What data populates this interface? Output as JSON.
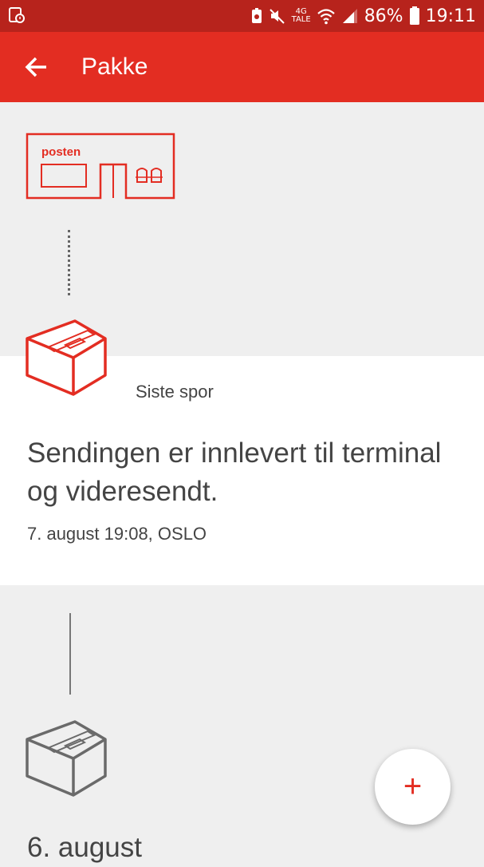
{
  "status_bar": {
    "network": "4G",
    "network_sub": "TALE",
    "battery": "86%",
    "time": "19:11"
  },
  "app_bar": {
    "title": "Pakke",
    "back_icon": "arrow-left-icon"
  },
  "illustration": {
    "sign_text": "posten"
  },
  "latest_event": {
    "label": "Siste spor",
    "message": "Sendingen er innlevert til terminal og videresendt.",
    "date_place": "7. august 19:08, OSLO"
  },
  "history": {
    "date_heading": "6. august"
  },
  "fab": {
    "icon": "plus-icon",
    "glyph": "+"
  },
  "colors": {
    "status_bar": "#b7231c",
    "app_bar": "#e32d22",
    "accent": "#e32d22",
    "background": "#efefef",
    "card": "#ffffff"
  }
}
